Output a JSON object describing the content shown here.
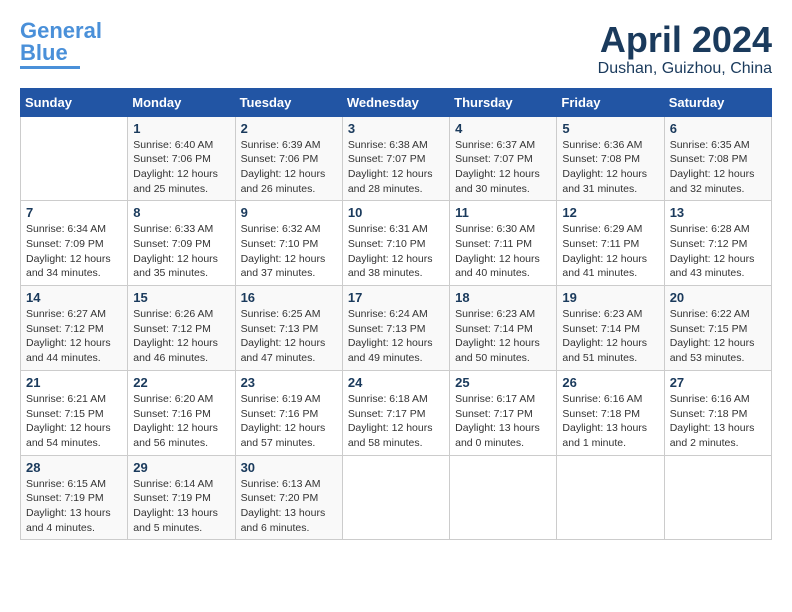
{
  "header": {
    "logo_general": "General",
    "logo_blue": "Blue",
    "month": "April 2024",
    "location": "Dushan, Guizhou, China"
  },
  "weekdays": [
    "Sunday",
    "Monday",
    "Tuesday",
    "Wednesday",
    "Thursday",
    "Friday",
    "Saturday"
  ],
  "weeks": [
    [
      {
        "day": "",
        "sunrise": "",
        "sunset": "",
        "daylight": ""
      },
      {
        "day": "1",
        "sunrise": "Sunrise: 6:40 AM",
        "sunset": "Sunset: 7:06 PM",
        "daylight": "Daylight: 12 hours and 25 minutes."
      },
      {
        "day": "2",
        "sunrise": "Sunrise: 6:39 AM",
        "sunset": "Sunset: 7:06 PM",
        "daylight": "Daylight: 12 hours and 26 minutes."
      },
      {
        "day": "3",
        "sunrise": "Sunrise: 6:38 AM",
        "sunset": "Sunset: 7:07 PM",
        "daylight": "Daylight: 12 hours and 28 minutes."
      },
      {
        "day": "4",
        "sunrise": "Sunrise: 6:37 AM",
        "sunset": "Sunset: 7:07 PM",
        "daylight": "Daylight: 12 hours and 30 minutes."
      },
      {
        "day": "5",
        "sunrise": "Sunrise: 6:36 AM",
        "sunset": "Sunset: 7:08 PM",
        "daylight": "Daylight: 12 hours and 31 minutes."
      },
      {
        "day": "6",
        "sunrise": "Sunrise: 6:35 AM",
        "sunset": "Sunset: 7:08 PM",
        "daylight": "Daylight: 12 hours and 32 minutes."
      }
    ],
    [
      {
        "day": "7",
        "sunrise": "Sunrise: 6:34 AM",
        "sunset": "Sunset: 7:09 PM",
        "daylight": "Daylight: 12 hours and 34 minutes."
      },
      {
        "day": "8",
        "sunrise": "Sunrise: 6:33 AM",
        "sunset": "Sunset: 7:09 PM",
        "daylight": "Daylight: 12 hours and 35 minutes."
      },
      {
        "day": "9",
        "sunrise": "Sunrise: 6:32 AM",
        "sunset": "Sunset: 7:10 PM",
        "daylight": "Daylight: 12 hours and 37 minutes."
      },
      {
        "day": "10",
        "sunrise": "Sunrise: 6:31 AM",
        "sunset": "Sunset: 7:10 PM",
        "daylight": "Daylight: 12 hours and 38 minutes."
      },
      {
        "day": "11",
        "sunrise": "Sunrise: 6:30 AM",
        "sunset": "Sunset: 7:11 PM",
        "daylight": "Daylight: 12 hours and 40 minutes."
      },
      {
        "day": "12",
        "sunrise": "Sunrise: 6:29 AM",
        "sunset": "Sunset: 7:11 PM",
        "daylight": "Daylight: 12 hours and 41 minutes."
      },
      {
        "day": "13",
        "sunrise": "Sunrise: 6:28 AM",
        "sunset": "Sunset: 7:12 PM",
        "daylight": "Daylight: 12 hours and 43 minutes."
      }
    ],
    [
      {
        "day": "14",
        "sunrise": "Sunrise: 6:27 AM",
        "sunset": "Sunset: 7:12 PM",
        "daylight": "Daylight: 12 hours and 44 minutes."
      },
      {
        "day": "15",
        "sunrise": "Sunrise: 6:26 AM",
        "sunset": "Sunset: 7:12 PM",
        "daylight": "Daylight: 12 hours and 46 minutes."
      },
      {
        "day": "16",
        "sunrise": "Sunrise: 6:25 AM",
        "sunset": "Sunset: 7:13 PM",
        "daylight": "Daylight: 12 hours and 47 minutes."
      },
      {
        "day": "17",
        "sunrise": "Sunrise: 6:24 AM",
        "sunset": "Sunset: 7:13 PM",
        "daylight": "Daylight: 12 hours and 49 minutes."
      },
      {
        "day": "18",
        "sunrise": "Sunrise: 6:23 AM",
        "sunset": "Sunset: 7:14 PM",
        "daylight": "Daylight: 12 hours and 50 minutes."
      },
      {
        "day": "19",
        "sunrise": "Sunrise: 6:23 AM",
        "sunset": "Sunset: 7:14 PM",
        "daylight": "Daylight: 12 hours and 51 minutes."
      },
      {
        "day": "20",
        "sunrise": "Sunrise: 6:22 AM",
        "sunset": "Sunset: 7:15 PM",
        "daylight": "Daylight: 12 hours and 53 minutes."
      }
    ],
    [
      {
        "day": "21",
        "sunrise": "Sunrise: 6:21 AM",
        "sunset": "Sunset: 7:15 PM",
        "daylight": "Daylight: 12 hours and 54 minutes."
      },
      {
        "day": "22",
        "sunrise": "Sunrise: 6:20 AM",
        "sunset": "Sunset: 7:16 PM",
        "daylight": "Daylight: 12 hours and 56 minutes."
      },
      {
        "day": "23",
        "sunrise": "Sunrise: 6:19 AM",
        "sunset": "Sunset: 7:16 PM",
        "daylight": "Daylight: 12 hours and 57 minutes."
      },
      {
        "day": "24",
        "sunrise": "Sunrise: 6:18 AM",
        "sunset": "Sunset: 7:17 PM",
        "daylight": "Daylight: 12 hours and 58 minutes."
      },
      {
        "day": "25",
        "sunrise": "Sunrise: 6:17 AM",
        "sunset": "Sunset: 7:17 PM",
        "daylight": "Daylight: 13 hours and 0 minutes."
      },
      {
        "day": "26",
        "sunrise": "Sunrise: 6:16 AM",
        "sunset": "Sunset: 7:18 PM",
        "daylight": "Daylight: 13 hours and 1 minute."
      },
      {
        "day": "27",
        "sunrise": "Sunrise: 6:16 AM",
        "sunset": "Sunset: 7:18 PM",
        "daylight": "Daylight: 13 hours and 2 minutes."
      }
    ],
    [
      {
        "day": "28",
        "sunrise": "Sunrise: 6:15 AM",
        "sunset": "Sunset: 7:19 PM",
        "daylight": "Daylight: 13 hours and 4 minutes."
      },
      {
        "day": "29",
        "sunrise": "Sunrise: 6:14 AM",
        "sunset": "Sunset: 7:19 PM",
        "daylight": "Daylight: 13 hours and 5 minutes."
      },
      {
        "day": "30",
        "sunrise": "Sunrise: 6:13 AM",
        "sunset": "Sunset: 7:20 PM",
        "daylight": "Daylight: 13 hours and 6 minutes."
      },
      {
        "day": "",
        "sunrise": "",
        "sunset": "",
        "daylight": ""
      },
      {
        "day": "",
        "sunrise": "",
        "sunset": "",
        "daylight": ""
      },
      {
        "day": "",
        "sunrise": "",
        "sunset": "",
        "daylight": ""
      },
      {
        "day": "",
        "sunrise": "",
        "sunset": "",
        "daylight": ""
      }
    ]
  ]
}
